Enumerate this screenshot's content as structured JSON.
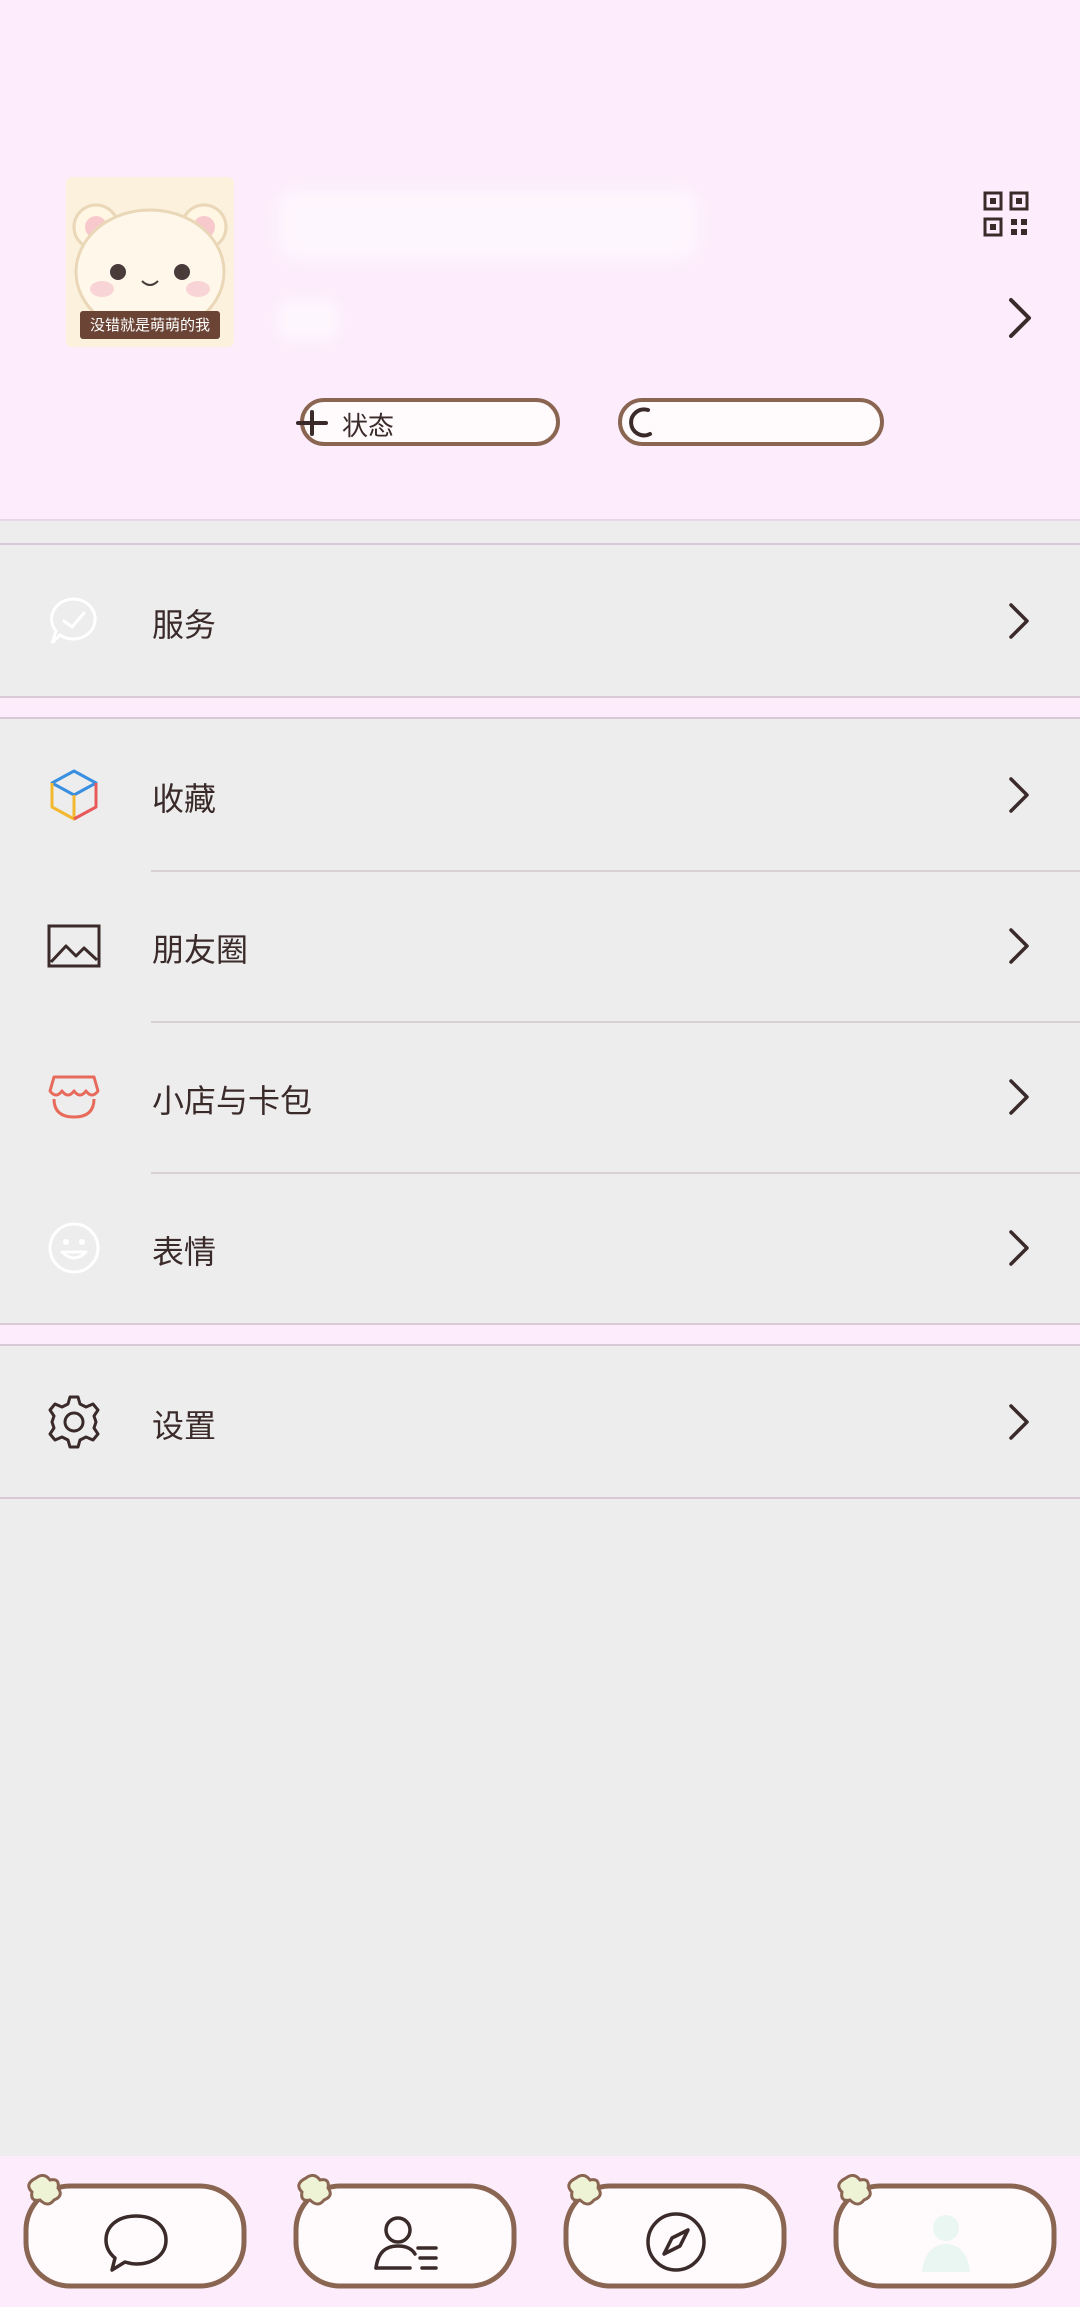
{
  "profile": {
    "avatar_caption": "没错就是萌萌的我",
    "status_label": "状态",
    "other_label": ""
  },
  "menu": {
    "section1": [
      {
        "label": "服务",
        "icon": "service-icon"
      }
    ],
    "section2": [
      {
        "label": "收藏",
        "icon": "favorites-cube-icon"
      },
      {
        "label": "朋友圈",
        "icon": "moments-image-icon"
      },
      {
        "label": "小店与卡包",
        "icon": "shop-icon"
      },
      {
        "label": "表情",
        "icon": "emoji-icon"
      }
    ],
    "section3": [
      {
        "label": "设置",
        "icon": "gear-icon"
      }
    ]
  },
  "tabbar": {
    "tabs": [
      {
        "name": "chats",
        "icon": "chat-bubble-icon"
      },
      {
        "name": "contacts",
        "icon": "contacts-icon"
      },
      {
        "name": "discover",
        "icon": "compass-icon"
      },
      {
        "name": "me",
        "icon": "person-icon",
        "selected": true
      }
    ]
  },
  "colors": {
    "header_bg": "#fdedfc",
    "page_bg": "#ededed",
    "frame_brown": "#8a6552",
    "accent_red": "#e86a5a"
  }
}
